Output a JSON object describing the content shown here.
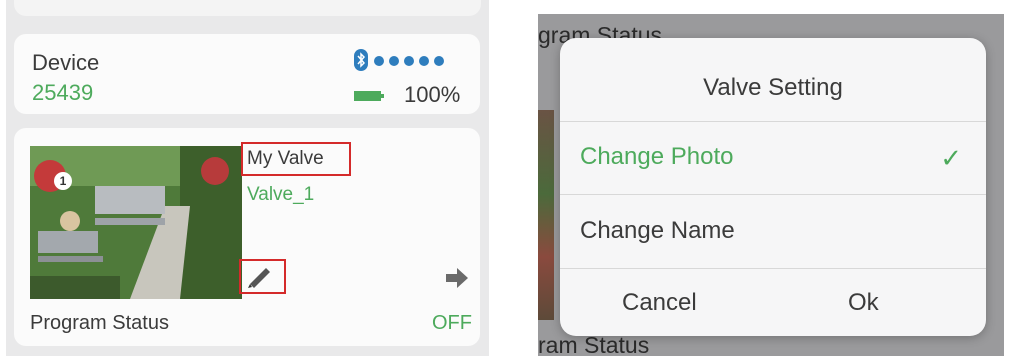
{
  "device_panel": {
    "device_label": "Device",
    "device_id": "25439",
    "battery_percent": "100%",
    "signal_icon": "signal-dots-icon",
    "bluetooth_icon": "bluetooth-icon",
    "battery_icon": "battery-icon"
  },
  "valve_card": {
    "photo_badge": "1",
    "valve_name": "My Valve",
    "valve_id": "Valve_1",
    "program_status_label": "Program Status",
    "program_status_value": "OFF"
  },
  "background_text": {
    "top": "gram Status",
    "bottom": "ram Status"
  },
  "valve_setting_dialog": {
    "title": "Valve Setting",
    "options": [
      {
        "label": "Change Photo",
        "selected": true
      },
      {
        "label": "Change Name",
        "selected": false
      }
    ],
    "check_mark": "✓",
    "cancel_label": "Cancel",
    "ok_label": "Ok"
  },
  "colors": {
    "accent_green": "#4daa5c",
    "highlight_red": "#d42a2a",
    "bluetooth_blue": "#2e7dbd"
  }
}
